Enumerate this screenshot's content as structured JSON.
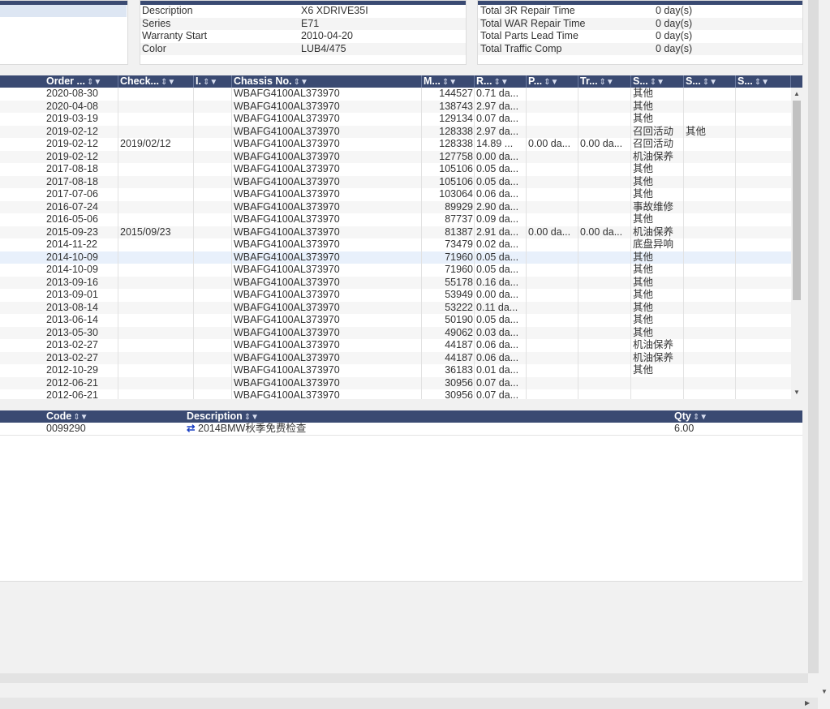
{
  "vehicle": {
    "rows": [
      {
        "label": "Description",
        "value": "X6 XDRIVE35I"
      },
      {
        "label": "Series",
        "value": "E71"
      },
      {
        "label": "Warranty Start",
        "value": "2010-04-20"
      },
      {
        "label": "Color",
        "value": "LUB4/475"
      }
    ]
  },
  "totals": {
    "rows": [
      {
        "label": "Total 3R Repair Time",
        "value": "0 day(s)"
      },
      {
        "label": "Total WAR Repair Time",
        "value": "0 day(s)"
      },
      {
        "label": "Total Parts Lead Time",
        "value": "0 day(s)"
      },
      {
        "label": "Total Traffic Comp",
        "value": "0 day(s)"
      }
    ]
  },
  "history": {
    "columns": [
      "Order ...",
      "Check...",
      "I.",
      "Chassis No.",
      "M...",
      "R...",
      "P...",
      "Tr...",
      "S...",
      "S...",
      "S..."
    ],
    "sort_icon": "⇕▼",
    "rows": [
      [
        "2020-08-30",
        "",
        "",
        "WBAFG4100AL373970",
        "144527",
        "0.71 da...",
        "",
        "",
        "其他",
        "",
        ""
      ],
      [
        "2020-04-08",
        "",
        "",
        "WBAFG4100AL373970",
        "138743",
        "2.97 da...",
        "",
        "",
        "其他",
        "",
        ""
      ],
      [
        "2019-03-19",
        "",
        "",
        "WBAFG4100AL373970",
        "129134",
        "0.07 da...",
        "",
        "",
        "其他",
        "",
        ""
      ],
      [
        "2019-02-12",
        "",
        "",
        "WBAFG4100AL373970",
        "128338",
        "2.97 da...",
        "",
        "",
        "召回活动",
        "其他",
        ""
      ],
      [
        "2019-02-12",
        "2019/02/12",
        "",
        "WBAFG4100AL373970",
        "128338",
        "14.89 ...",
        "0.00 da...",
        "0.00 da...",
        "召回活动",
        "",
        ""
      ],
      [
        "2019-02-12",
        "",
        "",
        "WBAFG4100AL373970",
        "127758",
        "0.00 da...",
        "",
        "",
        "机油保养",
        "",
        ""
      ],
      [
        "2017-08-18",
        "",
        "",
        "WBAFG4100AL373970",
        "105106",
        "0.05 da...",
        "",
        "",
        "其他",
        "",
        ""
      ],
      [
        "2017-08-18",
        "",
        "",
        "WBAFG4100AL373970",
        "105106",
        "0.05 da...",
        "",
        "",
        "其他",
        "",
        ""
      ],
      [
        "2017-07-06",
        "",
        "",
        "WBAFG4100AL373970",
        "103064",
        "0.06 da...",
        "",
        "",
        "其他",
        "",
        ""
      ],
      [
        "2016-07-24",
        "",
        "",
        "WBAFG4100AL373970",
        "89929",
        "2.90 da...",
        "",
        "",
        "事故维修",
        "",
        ""
      ],
      [
        "2016-05-06",
        "",
        "",
        "WBAFG4100AL373970",
        "87737",
        "0.09 da...",
        "",
        "",
        "其他",
        "",
        ""
      ],
      [
        "2015-09-23",
        "2015/09/23",
        "",
        "WBAFG4100AL373970",
        "81387",
        "2.91 da...",
        "0.00 da...",
        "0.00 da...",
        "机油保养",
        "",
        ""
      ],
      [
        "2014-11-22",
        "",
        "",
        "WBAFG4100AL373970",
        "73479",
        "0.02 da...",
        "",
        "",
        "底盘异响",
        "",
        ""
      ],
      [
        "2014-10-09",
        "",
        "",
        "WBAFG4100AL373970",
        "71960",
        "0.05 da...",
        "",
        "",
        "其他",
        "",
        ""
      ],
      [
        "2014-10-09",
        "",
        "",
        "WBAFG4100AL373970",
        "71960",
        "0.05 da...",
        "",
        "",
        "其他",
        "",
        ""
      ],
      [
        "2013-09-16",
        "",
        "",
        "WBAFG4100AL373970",
        "55178",
        "0.16 da...",
        "",
        "",
        "其他",
        "",
        ""
      ],
      [
        "2013-09-01",
        "",
        "",
        "WBAFG4100AL373970",
        "53949",
        "0.00 da...",
        "",
        "",
        "其他",
        "",
        ""
      ],
      [
        "2013-08-14",
        "",
        "",
        "WBAFG4100AL373970",
        "53222",
        "0.11 da...",
        "",
        "",
        "其他",
        "",
        ""
      ],
      [
        "2013-06-14",
        "",
        "",
        "WBAFG4100AL373970",
        "50190",
        "0.05 da...",
        "",
        "",
        "其他",
        "",
        ""
      ],
      [
        "2013-05-30",
        "",
        "",
        "WBAFG4100AL373970",
        "49062",
        "0.03 da...",
        "",
        "",
        "其他",
        "",
        ""
      ],
      [
        "2013-02-27",
        "",
        "",
        "WBAFG4100AL373970",
        "44187",
        "0.06 da...",
        "",
        "",
        "机油保养",
        "",
        ""
      ],
      [
        "2013-02-27",
        "",
        "",
        "WBAFG4100AL373970",
        "44187",
        "0.06 da...",
        "",
        "",
        "机油保养",
        "",
        ""
      ],
      [
        "2012-10-29",
        "",
        "",
        "WBAFG4100AL373970",
        "36183",
        "0.01 da...",
        "",
        "",
        "其他",
        "",
        ""
      ],
      [
        "2012-06-21",
        "",
        "",
        "WBAFG4100AL373970",
        "30956",
        "0.07 da...",
        "",
        "",
        "",
        "",
        ""
      ],
      [
        "2012-06-21",
        "",
        "",
        "WBAFG4100AL373970",
        "30956",
        "0.07 da...",
        "",
        "",
        "",
        "",
        ""
      ]
    ],
    "selected_row": 13
  },
  "details": {
    "columns": {
      "code": "Code",
      "description": "Description",
      "qty": "Qty"
    },
    "rows": [
      {
        "code": "0099290",
        "link_icon": "⇄",
        "description": "2014BMW秋季免费检查",
        "qty": "6.00"
      }
    ]
  },
  "colors": {
    "header": "#3a4a72",
    "selected": "#e8f0fb",
    "link_icon": "#1a3fc4"
  }
}
